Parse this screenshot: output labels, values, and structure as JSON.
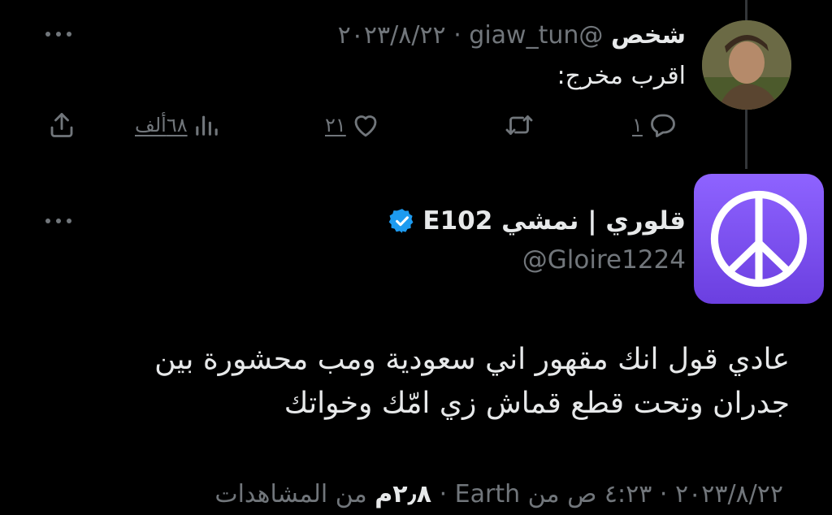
{
  "reply_tweet": {
    "display_name": "شخص",
    "handle": "@giaw_tun",
    "separator": "·",
    "date": "٢٠٢٣/٨/٢٢",
    "text": "اقرب مخرج:",
    "actions": {
      "reply_count": "١",
      "like_count": "٢١",
      "views_count": "٦٨ألف"
    }
  },
  "main_tweet": {
    "display_name": "قلوري | نمشي E102",
    "verified": true,
    "handle": "@Gloire1224",
    "text": "عادي قول انك مقهور اني سعودية ومب محشورة بين جدران وتحت قطع قماش زي امّك وخواتك",
    "footer": {
      "date_time": "٢٠٢٣/٨/٢٢ · ٤:٢٣ ص من Earth ·",
      "views": "٢٫٨م",
      "views_label": "من المشاهدات"
    }
  },
  "colors": {
    "background": "#000000",
    "text_primary": "#e7e9ea",
    "text_secondary": "#71767b",
    "verified_badge": "#1d9bf0",
    "avatar_purple": "#7c4dff"
  },
  "icons": {
    "more": "more-horizontal-icon",
    "reply": "comment-bubble-icon",
    "retweet": "retweet-icon",
    "like": "heart-icon",
    "views": "bar-chart-icon",
    "share": "share-upload-icon",
    "verified": "verified-badge-icon",
    "peace": "peace-symbol-icon"
  }
}
